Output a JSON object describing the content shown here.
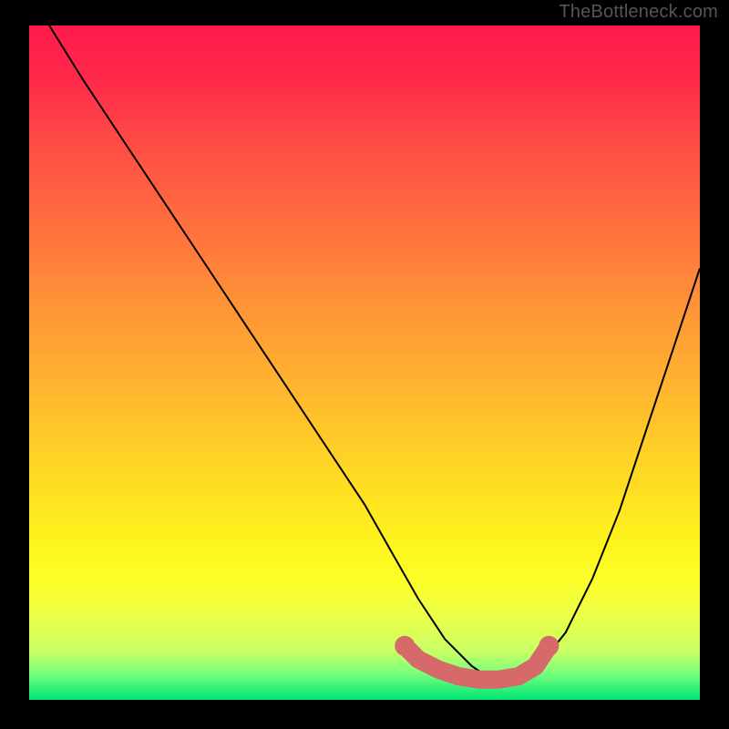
{
  "watermark": "TheBottleneck.com",
  "colors": {
    "gradient_top": "#ff1a4b",
    "gradient_mid": "#ffd226",
    "gradient_bottom": "#00e676",
    "curve": "#000000",
    "marker": "#d66a6a",
    "frame_bg": "#000000"
  },
  "chart_data": {
    "type": "line",
    "title": "",
    "xlabel": "",
    "ylabel": "",
    "xlim": [
      0,
      100
    ],
    "ylim": [
      0,
      100
    ],
    "note": "x/y are 0-100 relative to the gradient plot area (y=0 bottom).",
    "series": [
      {
        "name": "bottleneck-curve",
        "x": [
          3,
          8,
          14,
          20,
          26,
          32,
          38,
          44,
          50,
          54,
          58,
          62,
          66,
          69,
          72,
          76,
          80,
          84,
          88,
          92,
          96,
          100
        ],
        "y": [
          100,
          92,
          83,
          74,
          65,
          56,
          47,
          38,
          29,
          22,
          15,
          9,
          5,
          3,
          3,
          5,
          10,
          18,
          28,
          40,
          52,
          64
        ]
      }
    ],
    "markers": {
      "name": "optimal-range",
      "points": [
        {
          "x": 56,
          "y": 8
        },
        {
          "x": 58,
          "y": 6
        },
        {
          "x": 61,
          "y": 4.5
        },
        {
          "x": 64,
          "y": 3.5
        },
        {
          "x": 67,
          "y": 3
        },
        {
          "x": 70,
          "y": 3
        },
        {
          "x": 73,
          "y": 3.5
        },
        {
          "x": 75.5,
          "y": 5
        },
        {
          "x": 77.5,
          "y": 8
        }
      ]
    }
  }
}
